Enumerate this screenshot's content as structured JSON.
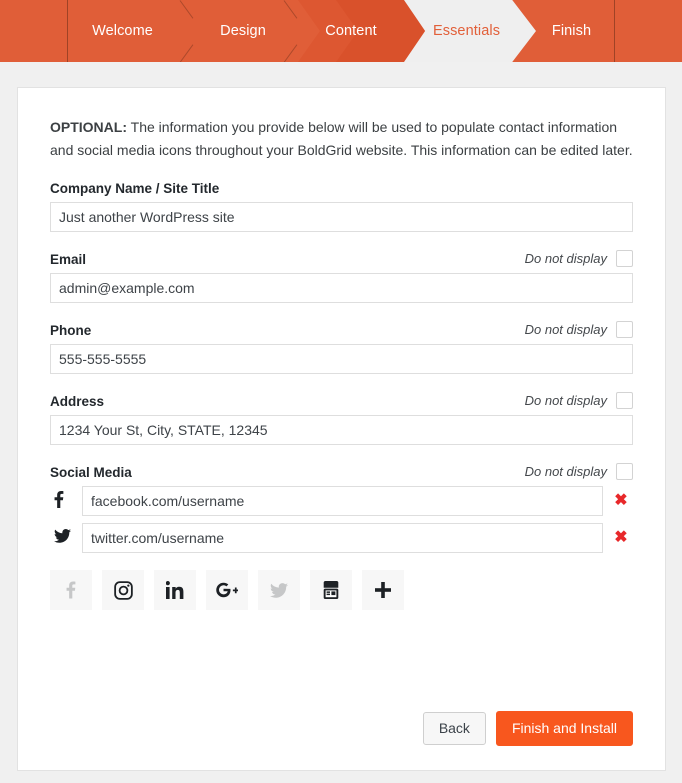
{
  "colors": {
    "header_orange": "#e05e38",
    "active_step_text": "#e2603a",
    "active_step_bg": "#efefef",
    "finish_button": "#f8571e",
    "delete_x": "#e8282a",
    "page_bg": "#f0f0f0"
  },
  "steps": [
    {
      "label": "Welcome",
      "state": "done"
    },
    {
      "label": "Design",
      "state": "done"
    },
    {
      "label": "Content",
      "state": "done"
    },
    {
      "label": "Essentials",
      "state": "active"
    },
    {
      "label": "Finish",
      "state": "upcoming"
    }
  ],
  "intro": {
    "prefix": "OPTIONAL:",
    "text": " The information you provide below will be used to populate contact information and social media icons throughout your BoldGrid website. This information can be edited later."
  },
  "do_not_display_label": "Do not display",
  "fields": [
    {
      "key": "company",
      "label": "Company Name / Site Title",
      "value": "Just another WordPress site",
      "placeholder": "Company Name / Site Title",
      "has_do_not_display": false
    },
    {
      "key": "email",
      "label": "Email",
      "value": "admin@example.com",
      "placeholder": "Email",
      "has_do_not_display": true
    },
    {
      "key": "phone",
      "label": "Phone",
      "value": "555-555-5555",
      "placeholder": "Phone",
      "has_do_not_display": true
    },
    {
      "key": "address",
      "label": "Address",
      "value": "1234 Your St, City, STATE, 12345",
      "placeholder": "Address",
      "has_do_not_display": true
    }
  ],
  "social": {
    "label": "Social Media",
    "rows": [
      {
        "icon": "facebook-icon",
        "value": "facebook.com/username",
        "placeholder": "facebook.com/username",
        "delete_label": "✖"
      },
      {
        "icon": "twitter-icon",
        "value": "twitter.com/username",
        "placeholder": "twitter.com/username",
        "delete_label": "✖"
      }
    ],
    "picker": [
      {
        "icon": "facebook-icon",
        "state": "used"
      },
      {
        "icon": "instagram-icon",
        "state": "available"
      },
      {
        "icon": "linkedin-icon",
        "state": "available"
      },
      {
        "icon": "googleplus-icon",
        "state": "available"
      },
      {
        "icon": "twitter-icon",
        "state": "used"
      },
      {
        "icon": "youtube-icon",
        "state": "available"
      },
      {
        "icon": "plus-icon",
        "state": "available"
      }
    ]
  },
  "footer": {
    "back_label": "Back",
    "finish_label": "Finish and Install"
  }
}
